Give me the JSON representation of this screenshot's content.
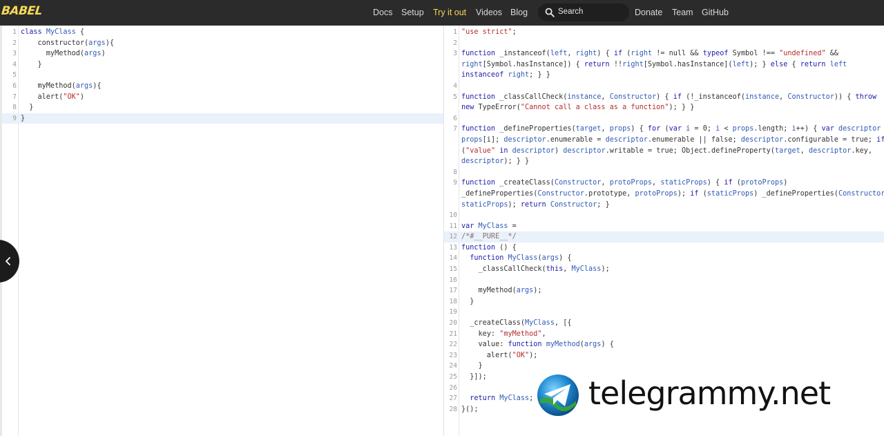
{
  "app": {
    "logo": "BABEL"
  },
  "nav": {
    "items": [
      {
        "label": "Docs",
        "active": false
      },
      {
        "label": "Setup",
        "active": false
      },
      {
        "label": "Try it out",
        "active": true
      },
      {
        "label": "Videos",
        "active": false
      },
      {
        "label": "Blog",
        "active": false
      },
      {
        "label": "Donate",
        "active": false
      },
      {
        "label": "Team",
        "active": false
      },
      {
        "label": "GitHub",
        "active": false
      }
    ],
    "search": {
      "label": "Search",
      "icon": "search-icon"
    }
  },
  "colors": {
    "topbar": "#2b2b2b",
    "accent": "#f5da55",
    "keyword": "#1c1ca8",
    "identifier": "#2f5bb5",
    "string": "#b42d2d",
    "highlight_line": "#e9f2fb"
  },
  "input": {
    "highlighted_line": 9,
    "lines": [
      {
        "n": "1",
        "tokens": [
          [
            "kw",
            "class "
          ],
          [
            "nm",
            "MyClass"
          ],
          [
            "plain",
            " {"
          ]
        ]
      },
      {
        "n": "2",
        "tokens": [
          [
            "plain",
            "    constructor("
          ],
          [
            "nm",
            "args"
          ],
          [
            "plain",
            "){"
          ]
        ]
      },
      {
        "n": "3",
        "tokens": [
          [
            "plain",
            "      myMethod("
          ],
          [
            "nm",
            "args"
          ],
          [
            "plain",
            ")"
          ]
        ]
      },
      {
        "n": "4",
        "tokens": [
          [
            "plain",
            "    }"
          ]
        ]
      },
      {
        "n": "5",
        "tokens": []
      },
      {
        "n": "6",
        "tokens": [
          [
            "plain",
            "    myMethod("
          ],
          [
            "nm",
            "args"
          ],
          [
            "plain",
            "){"
          ]
        ]
      },
      {
        "n": "7",
        "tokens": [
          [
            "plain",
            "    alert("
          ],
          [
            "str",
            "\"OK\""
          ],
          [
            "plain",
            ")"
          ]
        ]
      },
      {
        "n": "8",
        "tokens": [
          [
            "plain",
            "  }"
          ]
        ]
      },
      {
        "n": "9",
        "tokens": [
          [
            "plain",
            "}"
          ]
        ]
      }
    ]
  },
  "output": {
    "highlighted_line": 12,
    "lines": [
      {
        "n": "1",
        "tokens": [
          [
            "str",
            "\"use strict\""
          ],
          [
            "plain",
            ";"
          ]
        ]
      },
      {
        "n": "2",
        "tokens": []
      },
      {
        "n": "3",
        "tokens": [
          [
            "kw",
            "function "
          ],
          [
            "plain",
            "_instanceof("
          ],
          [
            "nm",
            "left"
          ],
          [
            "plain",
            ", "
          ],
          [
            "nm",
            "right"
          ],
          [
            "plain",
            ") { "
          ],
          [
            "kw",
            "if"
          ],
          [
            "plain",
            " ("
          ],
          [
            "nm",
            "right"
          ],
          [
            "plain",
            " != null && "
          ],
          [
            "kw",
            "typeof"
          ],
          [
            "plain",
            " Symbol !== "
          ],
          [
            "str",
            "\"undefined\""
          ],
          [
            "plain",
            " &&"
          ]
        ]
      },
      {
        "n": "",
        "tokens": [
          [
            "nm",
            "right"
          ],
          [
            "plain",
            "[Symbol.hasInstance]) { "
          ],
          [
            "kw",
            "return"
          ],
          [
            "plain",
            " !!"
          ],
          [
            "nm",
            "right"
          ],
          [
            "plain",
            "[Symbol.hasInstance]("
          ],
          [
            "nm",
            "left"
          ],
          [
            "plain",
            "); } "
          ],
          [
            "kw",
            "else"
          ],
          [
            "plain",
            " { "
          ],
          [
            "kw",
            "return"
          ],
          [
            "plain",
            " "
          ],
          [
            "nm",
            "left"
          ]
        ]
      },
      {
        "n": "",
        "tokens": [
          [
            "kw",
            "instanceof"
          ],
          [
            "plain",
            " "
          ],
          [
            "nm",
            "right"
          ],
          [
            "plain",
            "; } }"
          ]
        ]
      },
      {
        "n": "4",
        "tokens": []
      },
      {
        "n": "5",
        "tokens": [
          [
            "kw",
            "function "
          ],
          [
            "plain",
            "_classCallCheck("
          ],
          [
            "nm",
            "instance"
          ],
          [
            "plain",
            ", "
          ],
          [
            "nm",
            "Constructor"
          ],
          [
            "plain",
            ") { "
          ],
          [
            "kw",
            "if"
          ],
          [
            "plain",
            " (!_instanceof("
          ],
          [
            "nm",
            "instance"
          ],
          [
            "plain",
            ", "
          ],
          [
            "nm",
            "Constructor"
          ],
          [
            "plain",
            ")) { "
          ],
          [
            "kw",
            "throw"
          ]
        ]
      },
      {
        "n": "",
        "tokens": [
          [
            "kw",
            "new"
          ],
          [
            "plain",
            " TypeError("
          ],
          [
            "str",
            "\"Cannot call a class as a function\""
          ],
          [
            "plain",
            "); } }"
          ]
        ]
      },
      {
        "n": "6",
        "tokens": []
      },
      {
        "n": "7",
        "tokens": [
          [
            "kw",
            "function "
          ],
          [
            "plain",
            "_defineProperties("
          ],
          [
            "nm",
            "target"
          ],
          [
            "plain",
            ", "
          ],
          [
            "nm",
            "props"
          ],
          [
            "plain",
            ") { "
          ],
          [
            "kw",
            "for"
          ],
          [
            "plain",
            " ("
          ],
          [
            "kw",
            "var"
          ],
          [
            "plain",
            " "
          ],
          [
            "nm",
            "i"
          ],
          [
            "plain",
            " = 0; "
          ],
          [
            "nm",
            "i"
          ],
          [
            "plain",
            " < "
          ],
          [
            "nm",
            "props"
          ],
          [
            "plain",
            ".length; "
          ],
          [
            "nm",
            "i"
          ],
          [
            "plain",
            "++) { "
          ],
          [
            "kw",
            "var"
          ],
          [
            "plain",
            " "
          ],
          [
            "nm",
            "descriptor"
          ],
          [
            "plain",
            " ="
          ]
        ]
      },
      {
        "n": "",
        "tokens": [
          [
            "nm",
            "props"
          ],
          [
            "plain",
            "[i]; "
          ],
          [
            "nm",
            "descriptor"
          ],
          [
            "plain",
            ".enumerable = "
          ],
          [
            "nm",
            "descriptor"
          ],
          [
            "plain",
            ".enumerable || false; "
          ],
          [
            "nm",
            "descriptor"
          ],
          [
            "plain",
            ".configurable = true; "
          ],
          [
            "kw",
            "if"
          ]
        ]
      },
      {
        "n": "",
        "tokens": [
          [
            "plain",
            "("
          ],
          [
            "str",
            "\"value\""
          ],
          [
            "plain",
            " "
          ],
          [
            "kw",
            "in"
          ],
          [
            "plain",
            " "
          ],
          [
            "nm",
            "descriptor"
          ],
          [
            "plain",
            ") "
          ],
          [
            "nm",
            "descriptor"
          ],
          [
            "plain",
            ".writable = true; Object.defineProperty("
          ],
          [
            "nm",
            "target"
          ],
          [
            "plain",
            ", "
          ],
          [
            "nm",
            "descriptor"
          ],
          [
            "plain",
            ".key,"
          ]
        ]
      },
      {
        "n": "",
        "tokens": [
          [
            "nm",
            "descriptor"
          ],
          [
            "plain",
            "); } }"
          ]
        ]
      },
      {
        "n": "8",
        "tokens": []
      },
      {
        "n": "9",
        "tokens": [
          [
            "kw",
            "function "
          ],
          [
            "plain",
            "_createClass("
          ],
          [
            "nm",
            "Constructor"
          ],
          [
            "plain",
            ", "
          ],
          [
            "nm",
            "protoProps"
          ],
          [
            "plain",
            ", "
          ],
          [
            "nm",
            "staticProps"
          ],
          [
            "plain",
            ") { "
          ],
          [
            "kw",
            "if"
          ],
          [
            "plain",
            " ("
          ],
          [
            "nm",
            "protoProps"
          ],
          [
            "plain",
            ")"
          ]
        ]
      },
      {
        "n": "",
        "tokens": [
          [
            "plain",
            "_defineProperties("
          ],
          [
            "nm",
            "Constructor"
          ],
          [
            "plain",
            ".prototype, "
          ],
          [
            "nm",
            "protoProps"
          ],
          [
            "plain",
            "); "
          ],
          [
            "kw",
            "if"
          ],
          [
            "plain",
            " ("
          ],
          [
            "nm",
            "staticProps"
          ],
          [
            "plain",
            ") _defineProperties("
          ],
          [
            "nm",
            "Constructor"
          ],
          [
            "plain",
            ","
          ]
        ]
      },
      {
        "n": "",
        "tokens": [
          [
            "nm",
            "staticProps"
          ],
          [
            "plain",
            "); "
          ],
          [
            "kw",
            "return"
          ],
          [
            "plain",
            " "
          ],
          [
            "nm",
            "Constructor"
          ],
          [
            "plain",
            "; }"
          ]
        ]
      },
      {
        "n": "10",
        "tokens": []
      },
      {
        "n": "11",
        "tokens": [
          [
            "kw",
            "var "
          ],
          [
            "nm",
            "MyClass"
          ],
          [
            "plain",
            " ="
          ]
        ]
      },
      {
        "n": "12",
        "tokens": [
          [
            "cm",
            "/*#__PURE__*/"
          ]
        ]
      },
      {
        "n": "13",
        "tokens": [
          [
            "kw",
            "function"
          ],
          [
            "plain",
            " () {"
          ]
        ]
      },
      {
        "n": "14",
        "tokens": [
          [
            "plain",
            "  "
          ],
          [
            "kw",
            "function"
          ],
          [
            "plain",
            " "
          ],
          [
            "nm",
            "MyClass"
          ],
          [
            "plain",
            "("
          ],
          [
            "nm",
            "args"
          ],
          [
            "plain",
            ") {"
          ]
        ]
      },
      {
        "n": "15",
        "tokens": [
          [
            "plain",
            "    _classCallCheck("
          ],
          [
            "kw",
            "this"
          ],
          [
            "plain",
            ", "
          ],
          [
            "nm",
            "MyClass"
          ],
          [
            "plain",
            ");"
          ]
        ]
      },
      {
        "n": "16",
        "tokens": []
      },
      {
        "n": "17",
        "tokens": [
          [
            "plain",
            "    myMethod("
          ],
          [
            "nm",
            "args"
          ],
          [
            "plain",
            ");"
          ]
        ]
      },
      {
        "n": "18",
        "tokens": [
          [
            "plain",
            "  }"
          ]
        ]
      },
      {
        "n": "19",
        "tokens": []
      },
      {
        "n": "20",
        "tokens": [
          [
            "plain",
            "  _createClass("
          ],
          [
            "nm",
            "MyClass"
          ],
          [
            "plain",
            ", [{"
          ]
        ]
      },
      {
        "n": "21",
        "tokens": [
          [
            "plain",
            "    key: "
          ],
          [
            "str",
            "\"myMethod\""
          ],
          [
            "plain",
            ","
          ]
        ]
      },
      {
        "n": "22",
        "tokens": [
          [
            "plain",
            "    value: "
          ],
          [
            "kw",
            "function"
          ],
          [
            "plain",
            " "
          ],
          [
            "nm",
            "myMethod"
          ],
          [
            "plain",
            "("
          ],
          [
            "nm",
            "args"
          ],
          [
            "plain",
            ") {"
          ]
        ]
      },
      {
        "n": "23",
        "tokens": [
          [
            "plain",
            "      alert("
          ],
          [
            "str",
            "\"OK\""
          ],
          [
            "plain",
            ");"
          ]
        ]
      },
      {
        "n": "24",
        "tokens": [
          [
            "plain",
            "    }"
          ]
        ]
      },
      {
        "n": "25",
        "tokens": [
          [
            "plain",
            "  }]);"
          ]
        ]
      },
      {
        "n": "26",
        "tokens": []
      },
      {
        "n": "27",
        "tokens": [
          [
            "plain",
            "  "
          ],
          [
            "kw",
            "return"
          ],
          [
            "plain",
            " "
          ],
          [
            "nm",
            "MyClass"
          ],
          [
            "plain",
            ";"
          ]
        ]
      },
      {
        "n": "28",
        "tokens": [
          [
            "plain",
            "}();"
          ]
        ]
      }
    ]
  },
  "sidebar_toggle": {
    "icon": "chevron-left-icon"
  },
  "watermark": {
    "text": "telegrammy.net",
    "icon": "telegram-logo"
  }
}
